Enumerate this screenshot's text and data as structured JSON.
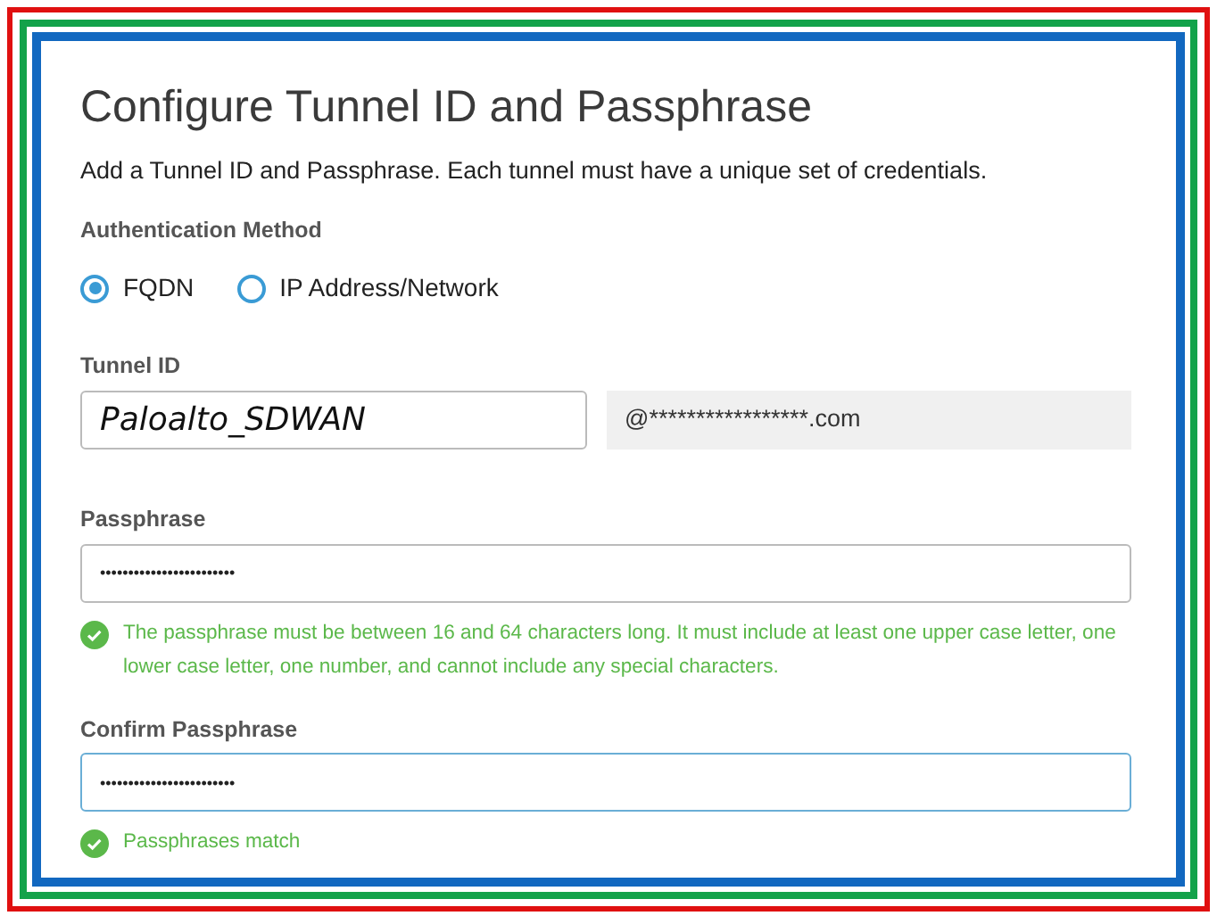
{
  "title": "Configure Tunnel ID and Passphrase",
  "description": "Add a Tunnel ID and Passphrase. Each tunnel must have a unique set of credentials.",
  "auth_method": {
    "label": "Authentication Method",
    "options": [
      {
        "label": "FQDN",
        "selected": true
      },
      {
        "label": "IP Address/Network",
        "selected": false
      }
    ]
  },
  "tunnel_id": {
    "label": "Tunnel ID",
    "value": "Paloalto_SDWAN",
    "suffix": "@*****************.com"
  },
  "passphrase": {
    "label": "Passphrase",
    "value": "••••••••••••••••••••••••",
    "focused": false,
    "help": "The passphrase must be between 16 and 64 characters long. It must include at least one upper case letter, one lower case letter, one number, and cannot include any special characters.",
    "valid": true
  },
  "confirm_passphrase": {
    "label": "Confirm Passphrase",
    "value": "••••••••••••••••••••••••",
    "focused": true,
    "help": "Passphrases match",
    "valid": true
  }
}
